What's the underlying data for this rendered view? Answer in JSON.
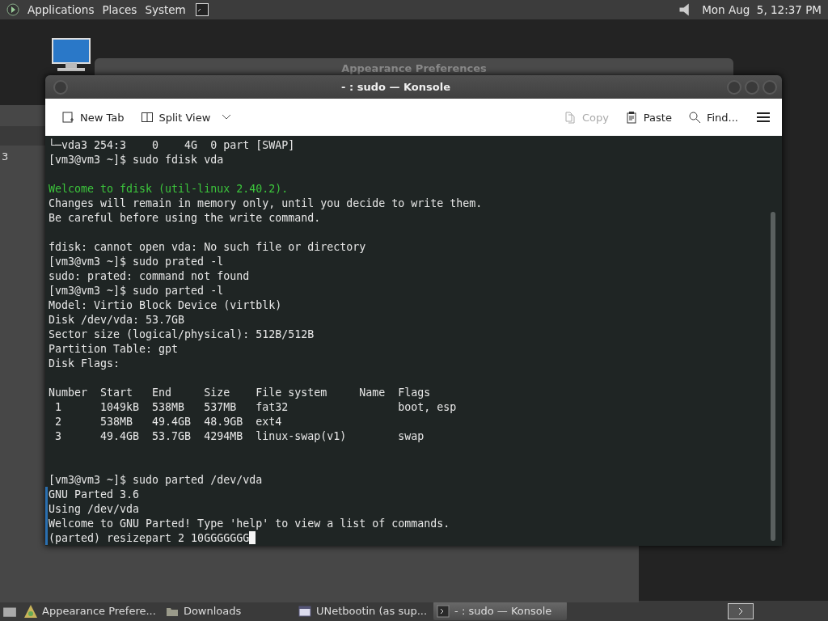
{
  "top_panel": {
    "menus": [
      "Applications",
      "Places",
      "System"
    ],
    "clock": "Mon Aug  5, 12:37 PM"
  },
  "background_window": {
    "title": "Appearance Preferences",
    "side_text": "3"
  },
  "window": {
    "title": "- : sudo — Konsole"
  },
  "toolbar": {
    "left": [
      {
        "label": "New Tab",
        "kind": "newtab",
        "disabled": false
      },
      {
        "label": "Split View",
        "kind": "split",
        "disabled": false
      }
    ],
    "right": [
      {
        "label": "Copy",
        "kind": "copy",
        "disabled": true
      },
      {
        "label": "Paste",
        "kind": "paste",
        "disabled": false
      },
      {
        "label": "Find...",
        "kind": "find",
        "disabled": false
      }
    ]
  },
  "terminal": {
    "lines": [
      {
        "text": "└─vda3 254:3    0    4G  0 part [SWAP]",
        "kind": "plain"
      },
      {
        "text": "[vm3@vm3 ~]$ sudo fdisk vda",
        "kind": "plain"
      },
      {
        "kind": "blank"
      },
      {
        "text": "Welcome to fdisk (util-linux 2.40.2).",
        "kind": "green"
      },
      {
        "text": "Changes will remain in memory only, until you decide to write them.",
        "kind": "plain"
      },
      {
        "text": "Be careful before using the write command.",
        "kind": "plain"
      },
      {
        "kind": "blank"
      },
      {
        "text": "fdisk: cannot open vda: No such file or directory",
        "kind": "plain"
      },
      {
        "text": "[vm3@vm3 ~]$ sudo prated -l",
        "kind": "plain"
      },
      {
        "text": "sudo: prated: command not found",
        "kind": "plain"
      },
      {
        "text": "[vm3@vm3 ~]$ sudo parted -l",
        "kind": "plain"
      },
      {
        "text": "Model: Virtio Block Device (virtblk)",
        "kind": "plain"
      },
      {
        "text": "Disk /dev/vda: 53.7GB",
        "kind": "plain"
      },
      {
        "text": "Sector size (logical/physical): 512B/512B",
        "kind": "plain"
      },
      {
        "text": "Partition Table: gpt",
        "kind": "plain"
      },
      {
        "text": "Disk Flags:",
        "kind": "plain"
      },
      {
        "kind": "blank"
      },
      {
        "text": "Number  Start   End     Size    File system     Name  Flags",
        "kind": "plain"
      },
      {
        "text": " 1      1049kB  538MB   537MB   fat32                 boot, esp",
        "kind": "plain"
      },
      {
        "text": " 2      538MB   49.4GB  48.9GB  ext4",
        "kind": "plain"
      },
      {
        "text": " 3      49.4GB  53.7GB  4294MB  linux-swap(v1)        swap",
        "kind": "plain"
      },
      {
        "kind": "blank"
      },
      {
        "kind": "blank"
      },
      {
        "text": "[vm3@vm3 ~]$ sudo parted /dev/vda",
        "kind": "plain"
      },
      {
        "text": "GNU Parted 3.6",
        "kind": "marked"
      },
      {
        "text": "Using /dev/vda",
        "kind": "marked"
      },
      {
        "text": "Welcome to GNU Parted! Type 'help' to view a list of commands.",
        "kind": "marked"
      },
      {
        "text": "(parted) resizepart 2 10GGGGGGG",
        "kind": "cursor"
      }
    ]
  },
  "taskbar": [
    {
      "label": "Appearance Prefere...",
      "kind": "prefs",
      "selected": false
    },
    {
      "label": "Downloads",
      "kind": "folder",
      "selected": false
    },
    {
      "label": "UNetbootin (as sup...",
      "kind": "app",
      "selected": false
    },
    {
      "label": "- : sudo — Konsole",
      "kind": "terminal",
      "selected": true
    }
  ]
}
